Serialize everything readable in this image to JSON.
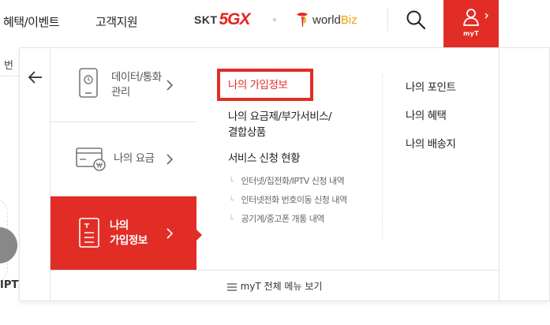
{
  "header": {
    "nav": [
      "혜택/이벤트",
      "고객지원"
    ],
    "brand_skt": "SKT",
    "brand_5gx": "5GX",
    "brand_worldbiz_1": "world",
    "brand_worldbiz_2": "Biz",
    "myt_label": "myT"
  },
  "background": {
    "fragment_top": "번",
    "fragment_bottom": "IPTV"
  },
  "left_menu": [
    {
      "label": "데이터/통화\n관리"
    },
    {
      "label": "나의 요금"
    },
    {
      "label": "나의\n가입정보"
    }
  ],
  "submenu": {
    "links": [
      "나의 가입정보",
      "나의 요금제/부가서비스/\n결합상품",
      "서비스 신청 현황"
    ],
    "sub_items": [
      "인터넷/집전화/IPTV 신청 내역",
      "인터넷전화 번호이동 신청 내역",
      "공기계/중고폰 개통 내역"
    ],
    "right_links": [
      "나의 포인트",
      "나의 혜택",
      "나의 배송지"
    ]
  },
  "footer": {
    "all_menu_label": "myT 전체 메뉴 보기"
  },
  "colors": {
    "accent": "#e22d27",
    "biz_orange": "#f0a000"
  },
  "icons": [
    "back-arrow-icon",
    "phone-clock-icon",
    "card-won-icon",
    "document-t-icon",
    "search-icon",
    "user-icon",
    "chevron-right-icon",
    "hamburger-icon"
  ]
}
